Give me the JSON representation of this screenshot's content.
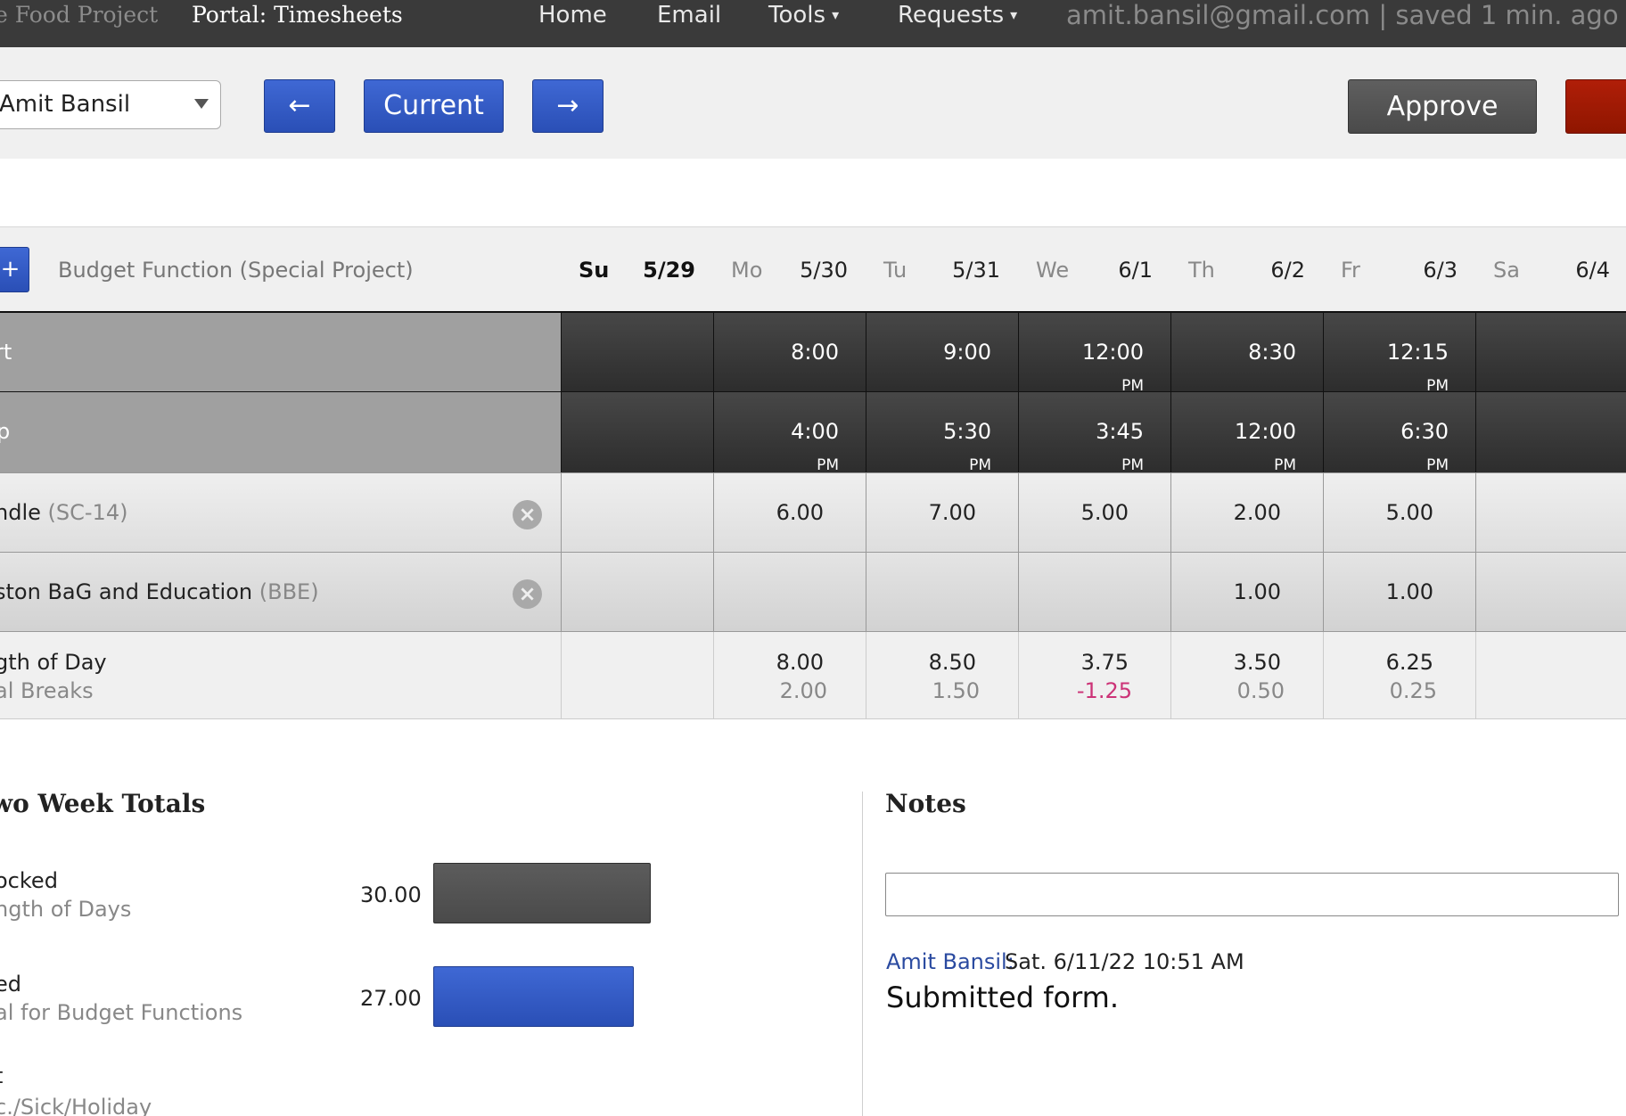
{
  "header": {
    "site_name": "e Food Project",
    "portal_title": "Portal: Timesheets",
    "nav": [
      "Home",
      "Email",
      "Tools",
      "Requests"
    ],
    "nav_caret": "▾",
    "status": "amit.bansil@gmail.com | saved 1 min. ago"
  },
  "toolbar": {
    "employee_select": "Amit Bansil",
    "prev_label": "←",
    "current_label": "Current",
    "next_label": "→",
    "approve_label": "Approve"
  },
  "grid": {
    "add_label": "+",
    "budget_label": "Budget Function (Special Project)",
    "days": [
      {
        "day": "Su",
        "date": "5/29",
        "bold": true
      },
      {
        "day": "Mo",
        "date": "5/30"
      },
      {
        "day": "Tu",
        "date": "5/31"
      },
      {
        "day": "We",
        "date": "6/1"
      },
      {
        "day": "Th",
        "date": "6/2"
      },
      {
        "day": "Fr",
        "date": "6/3"
      },
      {
        "day": "Sa",
        "date": "6/4"
      }
    ],
    "start_label": "rt",
    "stop_label": "p",
    "start_times": [
      "",
      "8:00",
      "9:00",
      "12:00",
      "8:30",
      "12:15",
      ""
    ],
    "start_pm": [
      "",
      "",
      "",
      "PM",
      "",
      "PM",
      ""
    ],
    "stop_times": [
      "",
      "4:00",
      "5:30",
      "3:45",
      "12:00",
      "6:30",
      ""
    ],
    "stop_pm": [
      "",
      "PM",
      "PM",
      "PM",
      "PM",
      "PM",
      ""
    ],
    "functions": [
      {
        "name": "ndle",
        "code": "(SC-14)",
        "values": [
          "",
          "6.00",
          "7.00",
          "5.00",
          "2.00",
          "5.00",
          ""
        ]
      },
      {
        "name": "ston BaG and Education",
        "code": "(BBE)",
        "values": [
          "",
          "",
          "",
          "",
          "1.00",
          "1.00",
          ""
        ]
      }
    ],
    "remove_icon": "×",
    "summary_label1": "gth of Day",
    "summary_label2": "al Breaks",
    "length_of_day": [
      "",
      "8.00",
      "8.50",
      "3.75",
      "3.50",
      "6.25",
      ""
    ],
    "breaks": [
      "",
      "2.00",
      "1.50",
      "-1.25",
      "0.50",
      "0.25",
      ""
    ]
  },
  "totals": {
    "title": "wo Week Totals",
    "rows": [
      {
        "label1": "ocked",
        "label2": "ngth of Days",
        "value": "30.00"
      },
      {
        "label1": "ed",
        "label2": "al for Budget Functions",
        "value": "27.00"
      },
      {
        "label1": "t",
        "label2": "c./Sick/Holiday",
        "value": ""
      }
    ]
  },
  "notes": {
    "title": "Notes",
    "input_value": "",
    "entry_author": "Amit Bansil:",
    "entry_time": "Sat. 6/11/22 10:51 AM",
    "entry_text": "Submitted form."
  },
  "colors": {
    "nav_bg": "#3a3a3a",
    "primary_blue": "#2f57c3",
    "approve_gray": "#555555",
    "danger_red": "#a01b04",
    "negative_pink": "#cc3377"
  }
}
